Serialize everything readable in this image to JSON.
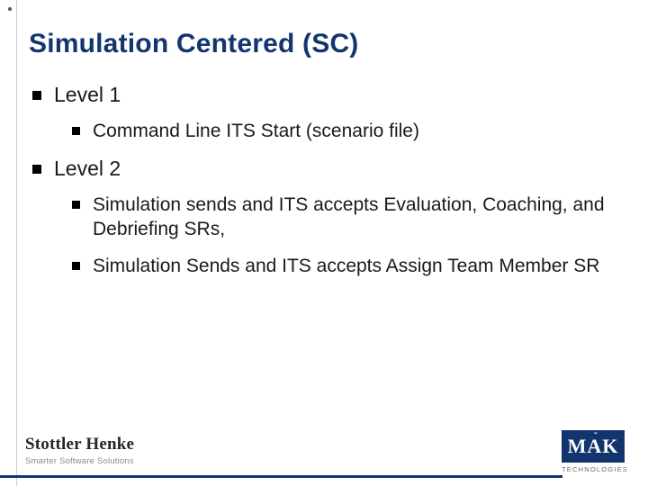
{
  "title": "Simulation Centered (SC)",
  "bullets": {
    "l1a": "Level 1",
    "l2a": "Command Line ITS Start (scenario file)",
    "l1b": "Level 2",
    "l2b": "Simulation sends and ITS accepts Evaluation, Coaching, and Debriefing SRs,",
    "l2c": " Simulation Sends and ITS accepts Assign Team Member SR"
  },
  "footer": {
    "sh_name": "Stottler Henke",
    "sh_tag": "Smarter Software Solutions",
    "mak": "MAK",
    "mak_tag": "TECHNOLOGIES"
  }
}
